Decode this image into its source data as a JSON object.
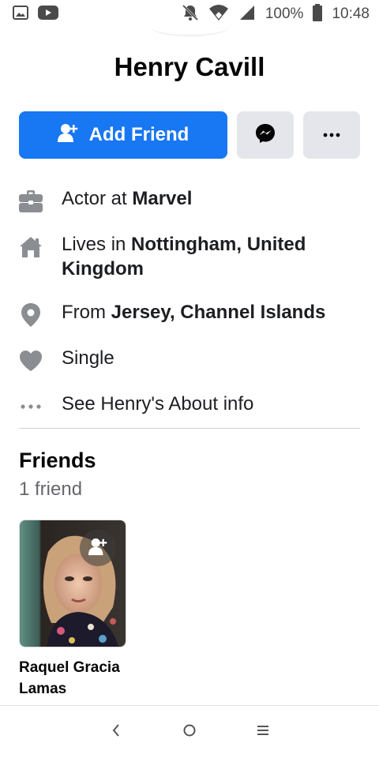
{
  "status_bar": {
    "battery": "100%",
    "time": "10:48",
    "icons": [
      "gallery-icon",
      "youtube-icon",
      "bell-muted-icon",
      "wifi-icon",
      "signal-icon",
      "battery-icon"
    ]
  },
  "profile": {
    "name": "Henry Cavill"
  },
  "actions": {
    "add_friend_label": "Add Friend",
    "messenger_icon": "messenger-icon",
    "more_icon": "more-icon"
  },
  "info": {
    "work": {
      "prefix": "Actor at ",
      "bold": "Marvel"
    },
    "lives": {
      "prefix": "Lives in ",
      "bold": "Nottingham, United Kingdom"
    },
    "from": {
      "prefix": "From ",
      "bold": "Jersey, Channel Islands"
    },
    "relationship": {
      "text": "Single"
    },
    "about": {
      "text": "See Henry's About info"
    }
  },
  "friends": {
    "title": "Friends",
    "count": "1 friend",
    "items": [
      {
        "name": "Raquel Gracia Lamas"
      }
    ]
  },
  "colors": {
    "primary": "#1877f2",
    "gray_button": "#e4e6eb",
    "secondary_text": "#65676b"
  }
}
